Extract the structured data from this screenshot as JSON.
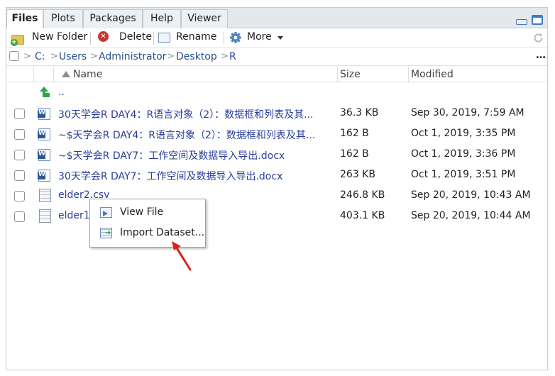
{
  "tabs": [
    {
      "label": "Files",
      "active": true
    },
    {
      "label": "Plots",
      "active": false
    },
    {
      "label": "Packages",
      "active": false
    },
    {
      "label": "Help",
      "active": false
    },
    {
      "label": "Viewer",
      "active": false
    }
  ],
  "toolbar": {
    "new_folder": "New Folder",
    "delete": "Delete",
    "rename": "Rename",
    "more": "More"
  },
  "breadcrumb": [
    "C:",
    "Users",
    "Administrator",
    "Desktop",
    "R"
  ],
  "more_label": "…",
  "columns": {
    "name": "Name",
    "size": "Size",
    "modified": "Modified"
  },
  "parent_dir": "..",
  "files": [
    {
      "name": "30天学会R DAY4：R语言对象（2）：数据框和列表及其...",
      "size": "36.3 KB",
      "modified": "Sep 30, 2019, 7:59 AM",
      "type": "word"
    },
    {
      "name": "~$天学会R DAY4：R语言对象（2）：数据框和列表及其...",
      "size": "162 B",
      "modified": "Oct 1, 2019, 3:35 PM",
      "type": "word"
    },
    {
      "name": "~$天学会R DAY7：工作空间及数据导入导出.docx",
      "size": "162 B",
      "modified": "Oct 1, 2019, 3:36 PM",
      "type": "word"
    },
    {
      "name": "30天学会R DAY7：工作空间及数据导入导出.docx",
      "size": "263 KB",
      "modified": "Oct 1, 2019, 3:51 PM",
      "type": "word"
    },
    {
      "name": "elder2.csv",
      "size": "246.8 KB",
      "modified": "Sep 20, 2019, 10:43 AM",
      "type": "csv"
    },
    {
      "name": "elder1.",
      "size": "403.1 KB",
      "modified": "Sep 20, 2019, 10:44 AM",
      "type": "csv"
    }
  ],
  "context_menu": {
    "view_file": "View File",
    "import_dataset": "Import Dataset..."
  },
  "colors": {
    "link": "#2a3d9a",
    "annotation_arrow": "#d9221c",
    "tab_bar": "#e4e8ec"
  }
}
